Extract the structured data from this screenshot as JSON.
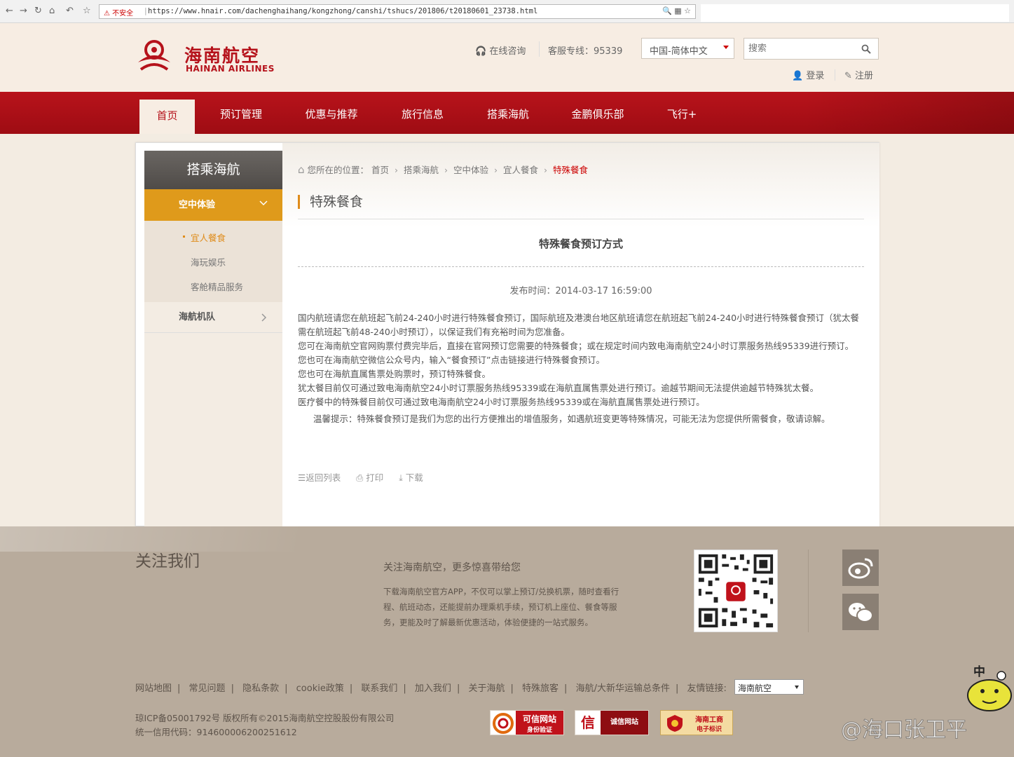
{
  "browser": {
    "security_label": "不安全",
    "url": "https://www.hnair.com/dachenghaihang/kongzhong/canshi/tshucs/201806/t20180601_23738.html"
  },
  "header": {
    "logo_cn": "海南航空",
    "logo_en": "HAINAN AIRLINES",
    "online_consult": "在线咨询",
    "hotline": "客服专线：95339",
    "language": "中国-简体中文",
    "search_placeholder": "搜索",
    "login": "登录",
    "register": "注册"
  },
  "nav": {
    "items": [
      "首页",
      "预订管理",
      "优惠与推荐",
      "旅行信息",
      "搭乘海航",
      "金鹏俱乐部",
      "飞行+"
    ]
  },
  "sidebar": {
    "title": "搭乘海航",
    "active_section": "空中体验",
    "sub_items": [
      "宜人餐食",
      "海玩娱乐",
      "客舱精品服务"
    ],
    "other_section": "海航机队"
  },
  "breadcrumb": {
    "prefix": "您所在的位置：",
    "items": [
      "首页",
      "搭乘海航",
      "空中体验",
      "宜人餐食"
    ],
    "current": "特殊餐食"
  },
  "article": {
    "section_title": "特殊餐食",
    "title": "特殊餐食预订方式",
    "publish_time": "发布时间：2014-03-17 16:59:00",
    "paragraphs": [
      "国内航班请您在航班起飞前24-240小时进行特殊餐食预订，国际航班及港澳台地区航班请您在航班起飞前24-240小时进行特殊餐食预订（犹太餐需在航班起飞前48-240小时预订），以保证我们有充裕时间为您准备。",
      "您可在海南航空官网购票付费完毕后，直接在官网预订您需要的特殊餐食；或在规定时间内致电海南航空24小时订票服务热线95339进行预订。",
      "您也可在海南航空微信公众号内，输入“餐食预订”点击链接进行特殊餐食预订。",
      "您也可在海航直属售票处购票时，预订特殊餐食。",
      "犹太餐目前仅可通过致电海南航空24小时订票服务热线95339或在海航直属售票处进行预订。逾越节期间无法提供逾越节特殊犹太餐。",
      "医疗餐中的特殊餐目前仅可通过致电海南航空24小时订票服务热线95339或在海航直属售票处进行预订。"
    ],
    "tip": "温馨提示：特殊餐食预订是我们为您的出行方便推出的增值服务，如遇航班变更等特殊情况，可能无法为您提供所需餐食，敬请谅解。",
    "tools": {
      "back": "返回列表",
      "print": "打印",
      "download": "下载"
    }
  },
  "footer": {
    "follow_title": "关注我们",
    "slogan": "关注海南航空，更多惊喜带给您",
    "description": "下载海南航空官方APP，不仅可以掌上预订/兑换机票，随时查看行程、航班动态，还能提前办理乘机手续，预订机上座位、餐食等服务，更能及时了解最新优惠活动，体验便捷的一站式服务。",
    "links": [
      "网站地图",
      "常见问题",
      "隐私条款",
      "cookie政策",
      "联系我们",
      "加入我们",
      "关于海航",
      "特殊旅客",
      "海航/大新华运输总条件"
    ],
    "friend_links_label": "友情链接:",
    "friend_links_selected": "海南航空",
    "icp": "琼ICP备05001792号 版权所有©2015海南航空控股股份有限公司",
    "credit_code": "统一信用代码：914600006200251612",
    "badges": [
      {
        "main": "可信网站",
        "sub": "身份验证"
      },
      {
        "main": "诚信网站",
        "sub": ""
      },
      {
        "main": "海南工商",
        "sub": "电子标识"
      }
    ]
  },
  "watermark": "@海口张卫平",
  "mascot_text": "中"
}
